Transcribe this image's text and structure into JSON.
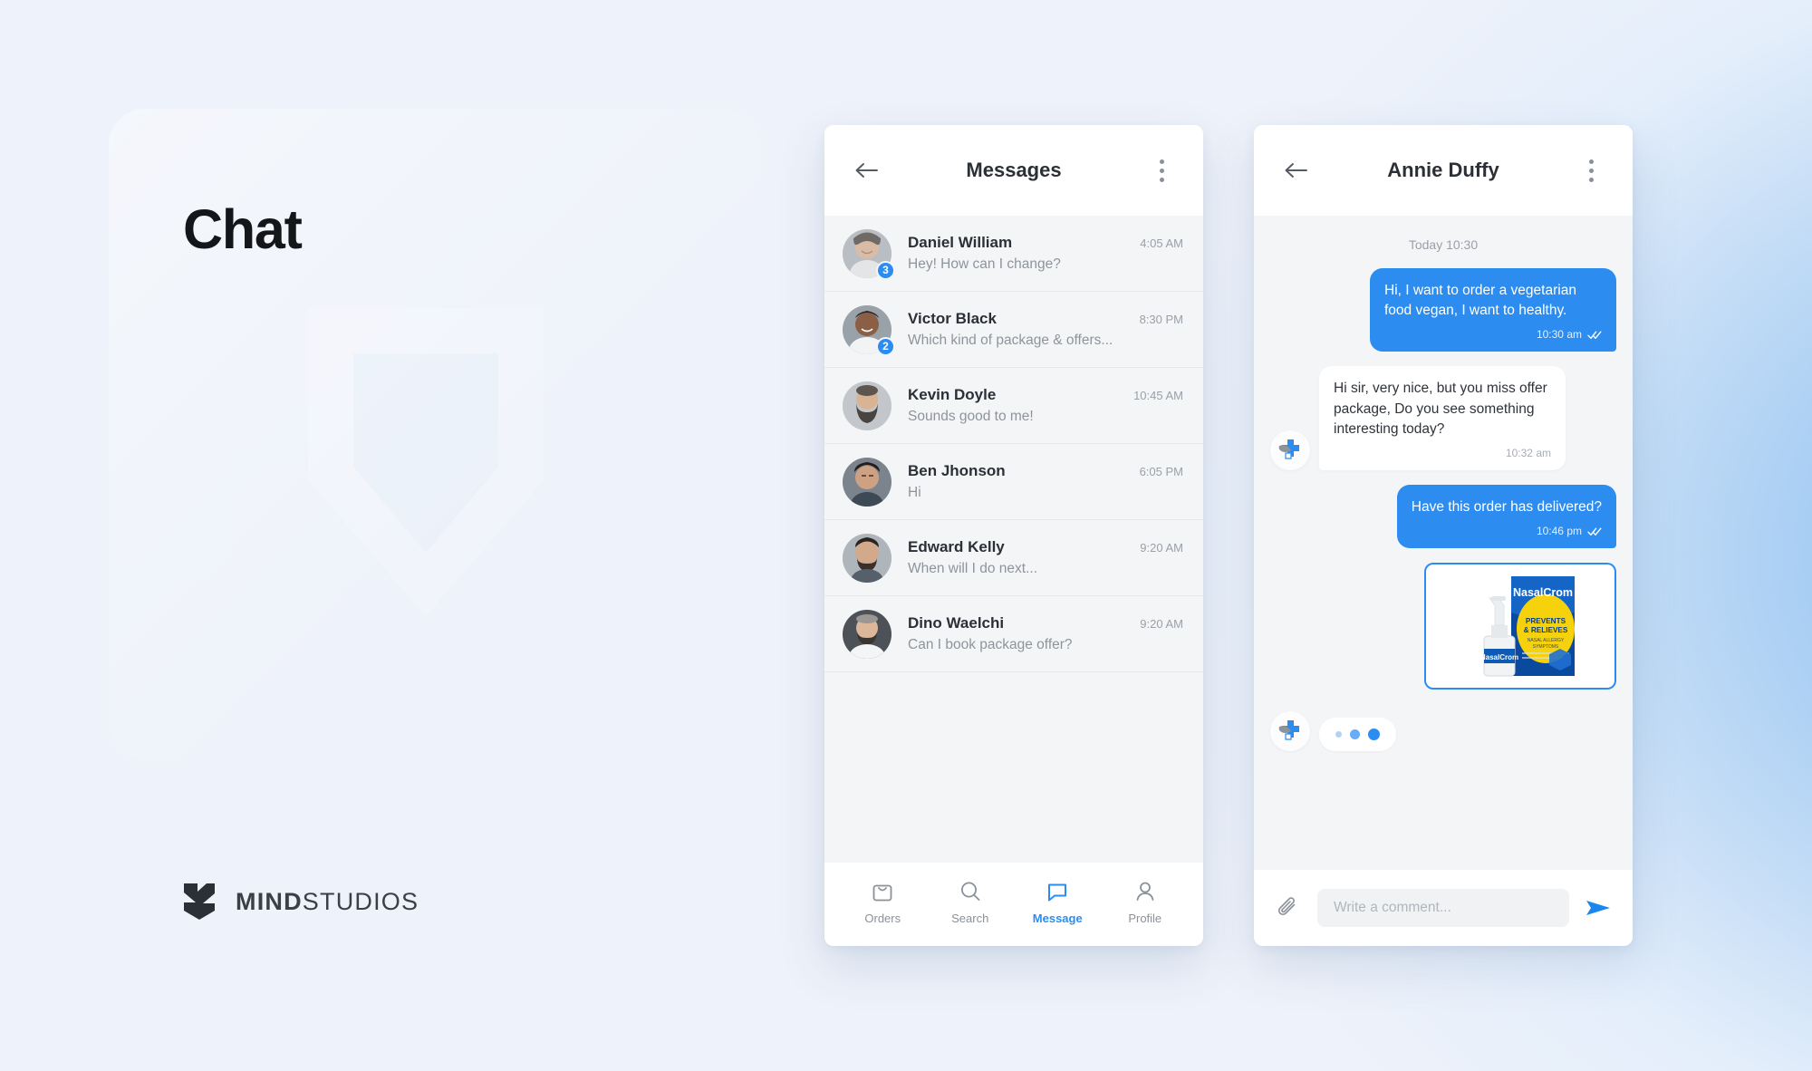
{
  "hero": {
    "title": "Chat",
    "brand_bold": "MIND",
    "brand_light": "STUDIOS"
  },
  "theme": {
    "accent": "#2d8cf0",
    "bubble_out_bg": "#2d8cf0",
    "bubble_in_bg": "#ffffff",
    "list_bg": "#f4f5f7",
    "card_bg": "#ffffff",
    "text_primary": "#2b2f36",
    "text_muted": "#8e949c",
    "bg_light": "#eef2fa",
    "bg_blue": "#8cc0ef"
  },
  "messages_screen": {
    "header": {
      "back_icon": "arrow-left-icon",
      "title": "Messages",
      "menu_icon": "kebab-menu-icon"
    },
    "conversations": [
      {
        "name": "Daniel William",
        "snippet": "Hey! How can I change?",
        "time": "4:05 AM",
        "badge": "3",
        "avatar": "avatar-daniel"
      },
      {
        "name": "Victor Black",
        "snippet": "Which kind of package & offers...",
        "time": "8:30 PM",
        "badge": "2",
        "avatar": "avatar-victor"
      },
      {
        "name": "Kevin Doyle",
        "snippet": "Sounds good to me!",
        "time": "10:45 AM",
        "badge": "",
        "avatar": "avatar-kevin"
      },
      {
        "name": "Ben Jhonson",
        "snippet": "Hi",
        "time": "6:05 PM",
        "badge": "",
        "avatar": "avatar-ben"
      },
      {
        "name": "Edward Kelly",
        "snippet": "When will I do next...",
        "time": "9:20 AM",
        "badge": "",
        "avatar": "avatar-edward"
      },
      {
        "name": "Dino Waelchi",
        "snippet": "Can I book package offer?",
        "time": "9:20 AM",
        "badge": "",
        "avatar": "avatar-dino"
      }
    ],
    "tabs": [
      {
        "label": "Orders",
        "icon": "shopping-bag-icon",
        "active": false
      },
      {
        "label": "Search",
        "icon": "search-icon",
        "active": false
      },
      {
        "label": "Message",
        "icon": "chat-bubble-icon",
        "active": true
      },
      {
        "label": "Profile",
        "icon": "person-icon",
        "active": false
      }
    ]
  },
  "chat_screen": {
    "header": {
      "back_icon": "arrow-left-icon",
      "title": "Annie Duffy",
      "menu_icon": "kebab-menu-icon"
    },
    "day_separator": "Today 10:30",
    "messages": [
      {
        "direction": "out",
        "text": "Hi, I want to order a vegetarian food vegan, I want to healthy.",
        "time": "10:30 am",
        "status_icon": "double-check-icon"
      },
      {
        "direction": "in",
        "text": "Hi sir, very nice, but you miss offer package, Do you see something interesting today?",
        "time": "10:32 am",
        "avatar": "pharmacy-cross-leaf-icon"
      },
      {
        "direction": "out",
        "text": "Have this order has delivered?",
        "time": "10:46 pm",
        "status_icon": "double-check-icon"
      },
      {
        "direction": "out",
        "type": "image",
        "product": {
          "brand": "NasalCrom",
          "headline": "PREVENTS & RELIEVES",
          "subhead": "NASAL ALLERGY SYMPTOMS"
        }
      }
    ],
    "typing_indicator": {
      "visible": true,
      "avatar": "pharmacy-cross-leaf-icon",
      "dots": 3
    },
    "composer": {
      "attach_icon": "paperclip-icon",
      "placeholder": "Write a comment...",
      "value": "",
      "send_icon": "send-icon"
    }
  }
}
